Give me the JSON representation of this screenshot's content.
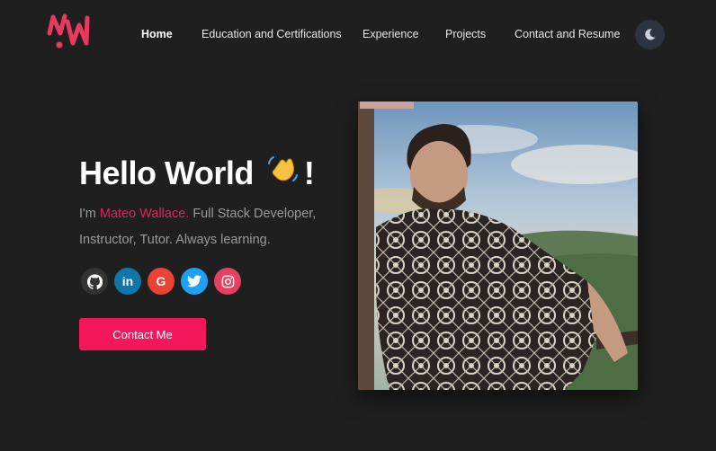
{
  "nav": {
    "links": [
      "Home",
      "Education and Certifications",
      "Experience",
      "Projects",
      "Contact and Resume"
    ],
    "active": "Home"
  },
  "hero": {
    "greeting": "Hello World",
    "exclaim": "!",
    "intro_prefix": "I'm ",
    "name": "Mateo Wallace.",
    "intro_suffix": " Full Stack Developer, Instructor, Tutor. Always learning.",
    "cta_label": "Contact Me"
  },
  "socials": [
    {
      "icon": "github-icon"
    },
    {
      "icon": "linkedin-icon",
      "glyph": "in"
    },
    {
      "icon": "google-icon",
      "glyph": "G"
    },
    {
      "icon": "twitter-icon"
    },
    {
      "icon": "instagram-icon"
    }
  ],
  "colors": {
    "background": "#1f1f1f",
    "accent": "#f5175b",
    "name": "#e0245e",
    "muted_text": "#9b9b9b",
    "theme_button": "#2e3342"
  }
}
